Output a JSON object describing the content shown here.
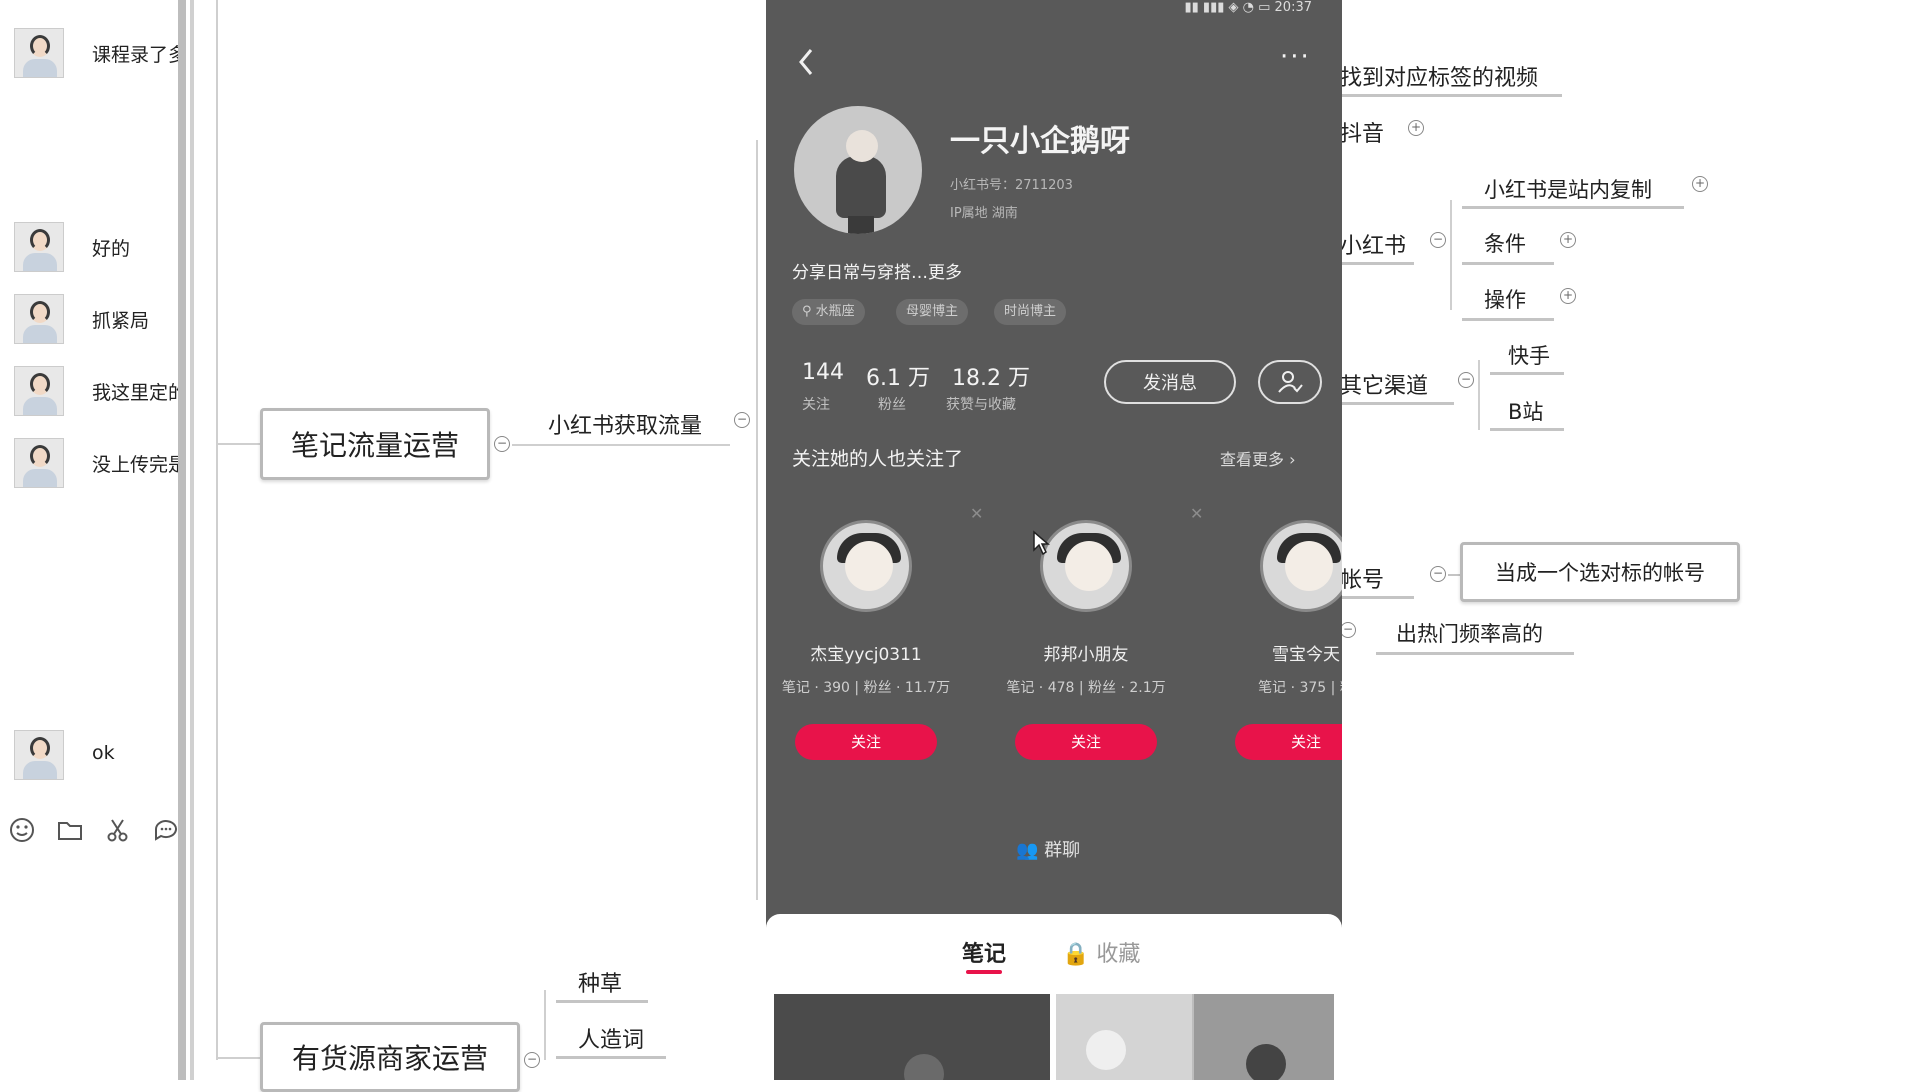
{
  "chat": {
    "messages": [
      {
        "text": "课程录了多"
      },
      {
        "text": "好的"
      },
      {
        "text": "抓紧局"
      },
      {
        "text": "我这里定的"
      },
      {
        "text": "没上传完是"
      },
      {
        "text": "ok"
      }
    ],
    "toolbar": [
      "emoji-icon",
      "folder-icon",
      "scissors-icon",
      "chat-bubble-icon"
    ]
  },
  "mindmap": {
    "left_main_1": "笔记流量运营",
    "left_branch": "小红书获取流量",
    "left_main_2": "有货源商家运营",
    "sub_1": "种草",
    "sub_2": "人造词",
    "right_top": "找到对应标签的视频",
    "douyin": "抖音",
    "xhs": "小红书",
    "xhs_child_1": "小红书是站内复制",
    "xhs_child_2": "条件",
    "xhs_child_3": "操作",
    "other_channels": "其它渠道",
    "kuaishou": "快手",
    "bilibili": "B站",
    "account": "帐号",
    "account_child_1": "当成一个选对标的帐号",
    "account_child_2": "出热门频率高的"
  },
  "phone": {
    "time": "20:37",
    "username": "一只小企鹅呀",
    "id_line": "小红书号：2711203",
    "ip_line": "IP属地  湖南",
    "bio": "分享日常与穿搭…更多",
    "tags": [
      "水瓶座",
      "母婴博主",
      "时尚博主"
    ],
    "stats": [
      {
        "num": "144",
        "label": "关注"
      },
      {
        "num": "6.1 万",
        "label": "粉丝"
      },
      {
        "num": "18.2 万",
        "label": "获赞与收藏"
      }
    ],
    "message_button": "发消息",
    "also_follow": "关注她的人也关注了",
    "see_more": "查看更多",
    "recommend": [
      {
        "name": "杰宝yycj0311",
        "meta": "笔记 · 390 | 粉丝 · 11.7万",
        "follow": "关注"
      },
      {
        "name": "邦邦小朋友",
        "meta": "笔记 · 478 | 粉丝 · 2.1万",
        "follow": "关注"
      },
      {
        "name": "雪宝今天",
        "meta": "笔记 · 375 | 粉",
        "follow": "关注"
      }
    ],
    "group_chat": "群聊",
    "tab_notes": "笔记",
    "tab_collect": "收藏"
  },
  "colors": {
    "phone_bg": "#595959",
    "follow_red": "#e8134a",
    "node_border": "#b9b9b9"
  }
}
